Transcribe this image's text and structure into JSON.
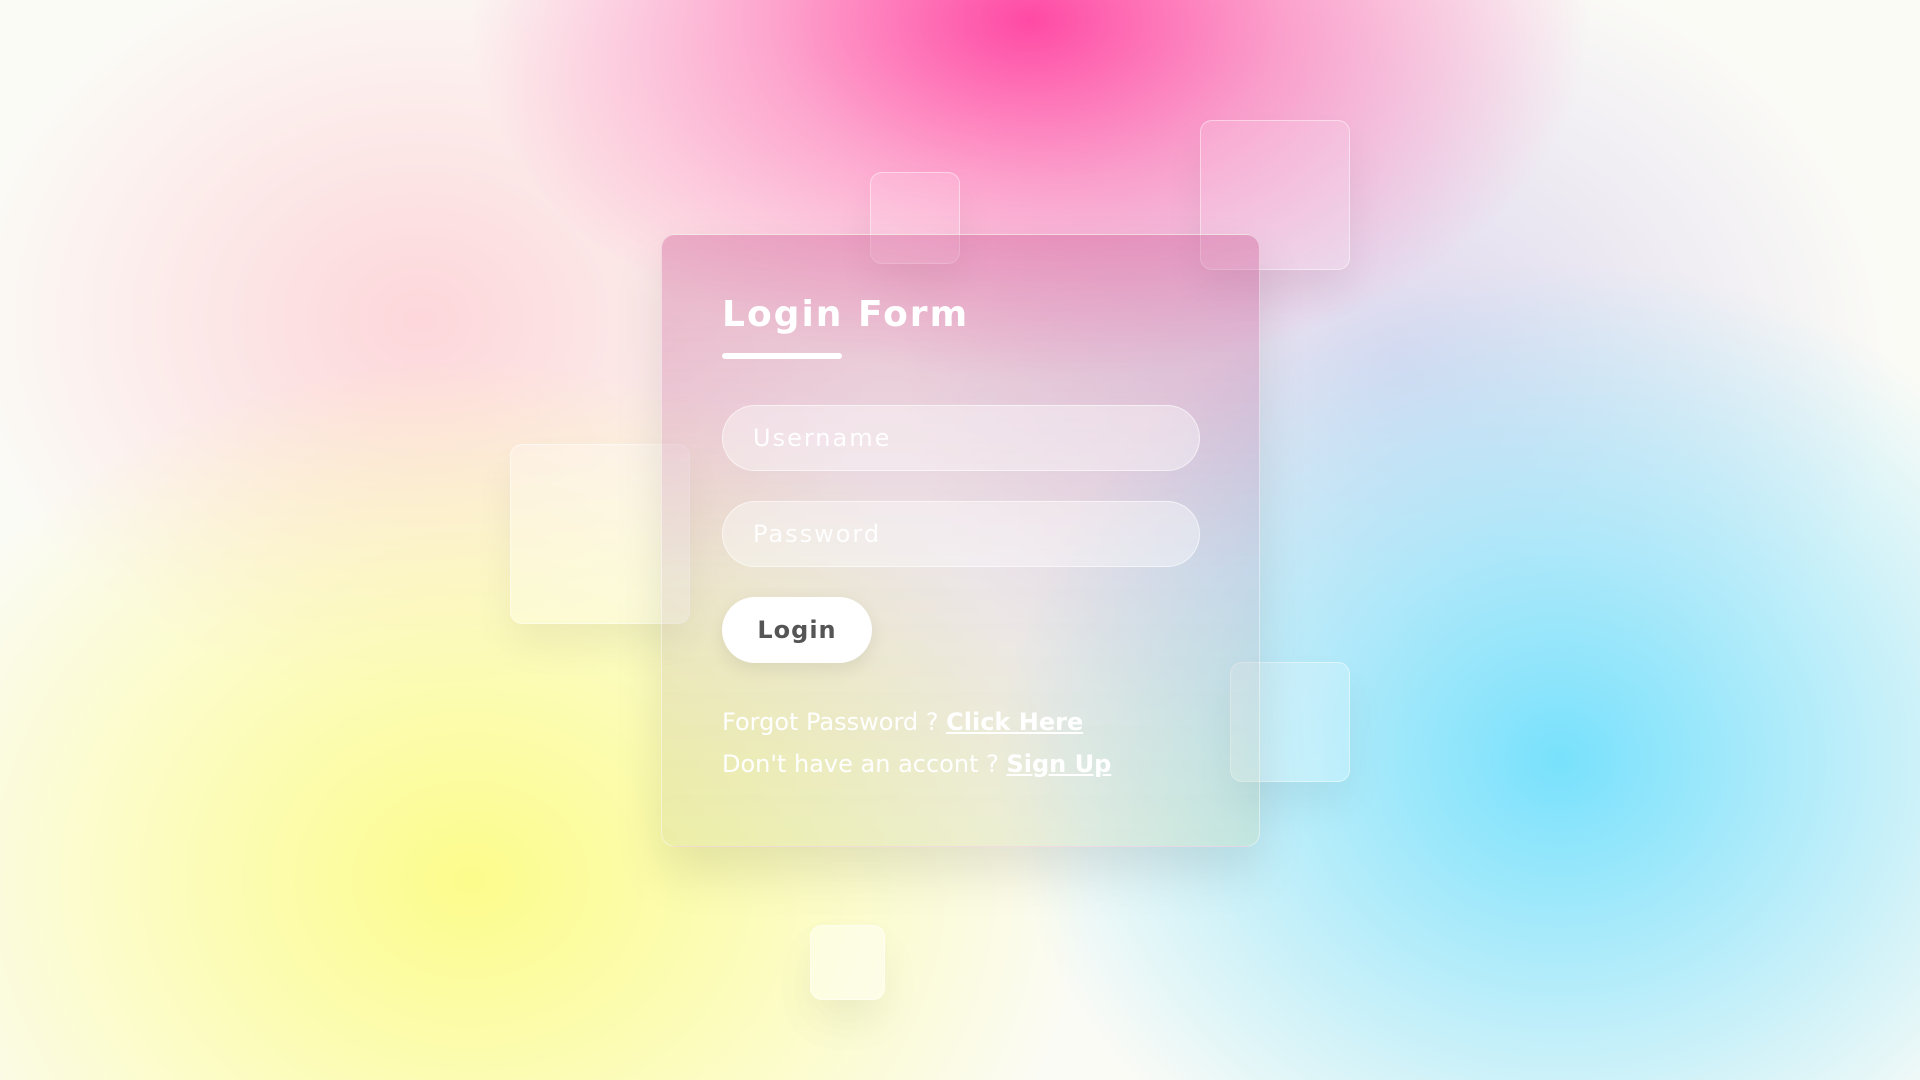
{
  "login_form": {
    "title": "Login Form",
    "username_placeholder": "Username",
    "password_placeholder": "Password",
    "login_label": "Login",
    "forgot_text": "Forgot Password ? ",
    "forgot_link": "Click Here",
    "signup_text": "Don't have an accont ? ",
    "signup_link": "Sign Up"
  },
  "colors": {
    "background_pink": "#ff4aa6",
    "background_yellow": "#fcfc8c",
    "background_cyan": "#78e1fc",
    "text": "#ffffff",
    "button_text": "#555555"
  }
}
